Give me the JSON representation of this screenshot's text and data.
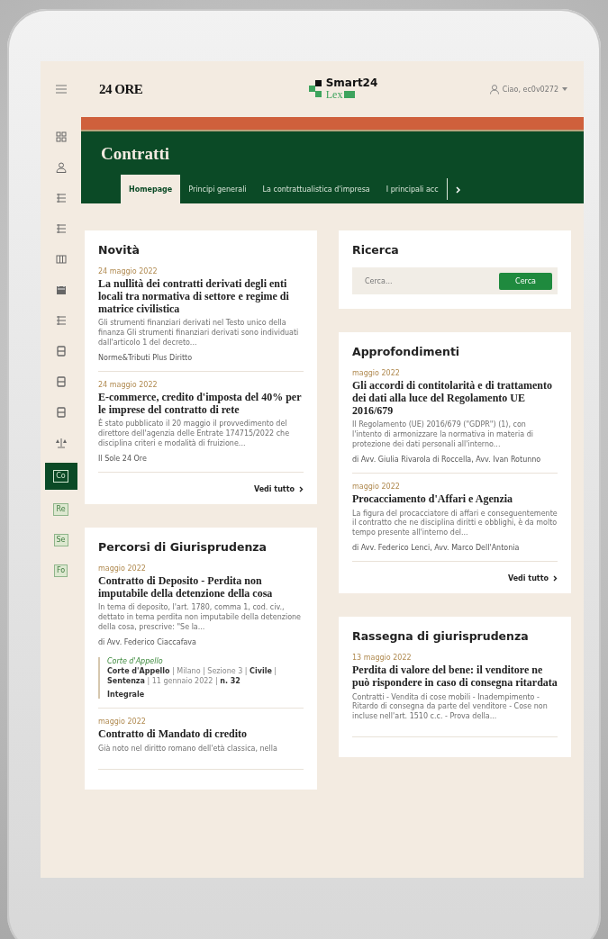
{
  "header": {
    "logo": "24 ORE",
    "brand": "Smart24",
    "brand_sub": "Lex",
    "user": "Ciao, ec0v0272"
  },
  "sidebar": {
    "items": [
      {
        "kind": "grid",
        "selected": false
      },
      {
        "kind": "user",
        "selected": false
      },
      {
        "kind": "list",
        "selected": false
      },
      {
        "kind": "list",
        "selected": false
      },
      {
        "kind": "columns",
        "selected": false
      },
      {
        "kind": "calendar",
        "selected": false
      },
      {
        "kind": "list",
        "selected": false
      },
      {
        "kind": "document",
        "selected": false
      },
      {
        "kind": "document",
        "selected": false
      },
      {
        "kind": "document",
        "selected": false
      },
      {
        "kind": "scales",
        "selected": false
      },
      {
        "kind": "code",
        "label": "Co",
        "selected": true
      },
      {
        "kind": "code",
        "label": "Re",
        "selected": false
      },
      {
        "kind": "code",
        "label": "Se",
        "selected": false
      },
      {
        "kind": "code",
        "label": "Fo",
        "selected": false
      }
    ]
  },
  "section": {
    "title": "Contratti",
    "tabs": [
      {
        "label": "Homepage",
        "selected": true
      },
      {
        "label": "Principi generali",
        "selected": false
      },
      {
        "label": "La contrattualistica d'impresa",
        "selected": false
      },
      {
        "label": "I principali acc",
        "selected": false
      }
    ]
  },
  "left_column": [
    {
      "kind": "news",
      "title": "Novità",
      "articles": [
        {
          "date": "24 maggio 2022",
          "title": "La nullità dei contratti derivati degli enti locali tra normativa di settore e regime di matrice civilistica",
          "snippet": "Gli strumenti finanziari derivati nel Testo unico della finanza Gli strumenti finanziari derivati sono individuati dall'articolo 1 del decreto...",
          "source": "Norme&Tributi Plus Diritto"
        },
        {
          "date": "24 maggio 2022",
          "title": "E-commerce, credito d'imposta del 40% per le imprese del contratto di rete",
          "snippet": "È stato pubblicato il 20 maggio il provvedimento del direttore dell'agenzia delle Entrate 174715/2022 che disciplina criteri e modalità di fruizione...",
          "source": "Il Sole 24 Ore"
        }
      ],
      "link": "Vedi tutto"
    },
    {
      "kind": "news",
      "title": "Percorsi di Giurisprudenza",
      "articles": [
        {
          "date": "maggio 2022",
          "title": "Contratto di Deposito - Perdita non imputabile della detenzione della cosa",
          "snippet": "In tema di deposito, l'art. 1780, comma 1, cod. civ., dettato in tema perdita non imputabile della detenzione della cosa, prescrive: \"Se la...",
          "source": "di Avv. Federico Ciaccafava",
          "ruling": {
            "label": "Corte d'Appello",
            "text": "**Corte d'Appello** | Milano | Sezione 3 | **Civile** | **Sentenza** | 11 gennaio 2022 | **n. 32**",
            "link": "Integrale"
          }
        },
        {
          "date": "maggio 2022",
          "title": "Contratto di Mandato di credito",
          "snippet": "Già noto nel diritto romano dell'età classica, nella"
        }
      ]
    }
  ],
  "right_column": [
    {
      "kind": "search",
      "title": "Ricerca",
      "placeholder": "Cerca...",
      "button": "Cerca"
    },
    {
      "kind": "news",
      "title": "Approfondimenti",
      "articles": [
        {
          "date": "maggio 2022",
          "title": "Gli accordi di contitolarità e di trattamento dei dati alla luce del Regolamento UE 2016/679",
          "snippet": "Il Regolamento (UE) 2016/679 (\"GDPR\") (1), con l'intento di armonizzare la normativa in materia di protezione dei dati personali all'interno...",
          "source": "di Avv. Giulia Rivarola di Roccella, Avv. Ivan Rotunno"
        },
        {
          "date": "maggio 2022",
          "title": "Procacciamento d'Affari e Agenzia",
          "snippet": "La figura del procacciatore di affari e conseguentemente il contratto che ne disciplina diritti e obblighi, è da molto tempo presente all'interno del...",
          "source": "di Avv. Federico Lenci, Avv. Marco Dell'Antonia"
        }
      ],
      "link": "Vedi tutto"
    },
    {
      "kind": "news",
      "title": "Rassegna di giurisprudenza",
      "articles": [
        {
          "date": "13 maggio 2022",
          "title": "Perdita di valore del bene: il venditore ne può rispondere in caso di consegna ritardata",
          "snippet": "Contratti - Vendita di cose mobili - Inadempimento - Ritardo di consegna da parte del venditore - Cose non incluse nell'art. 1510 c.c. - Prova della..."
        }
      ]
    }
  ]
}
